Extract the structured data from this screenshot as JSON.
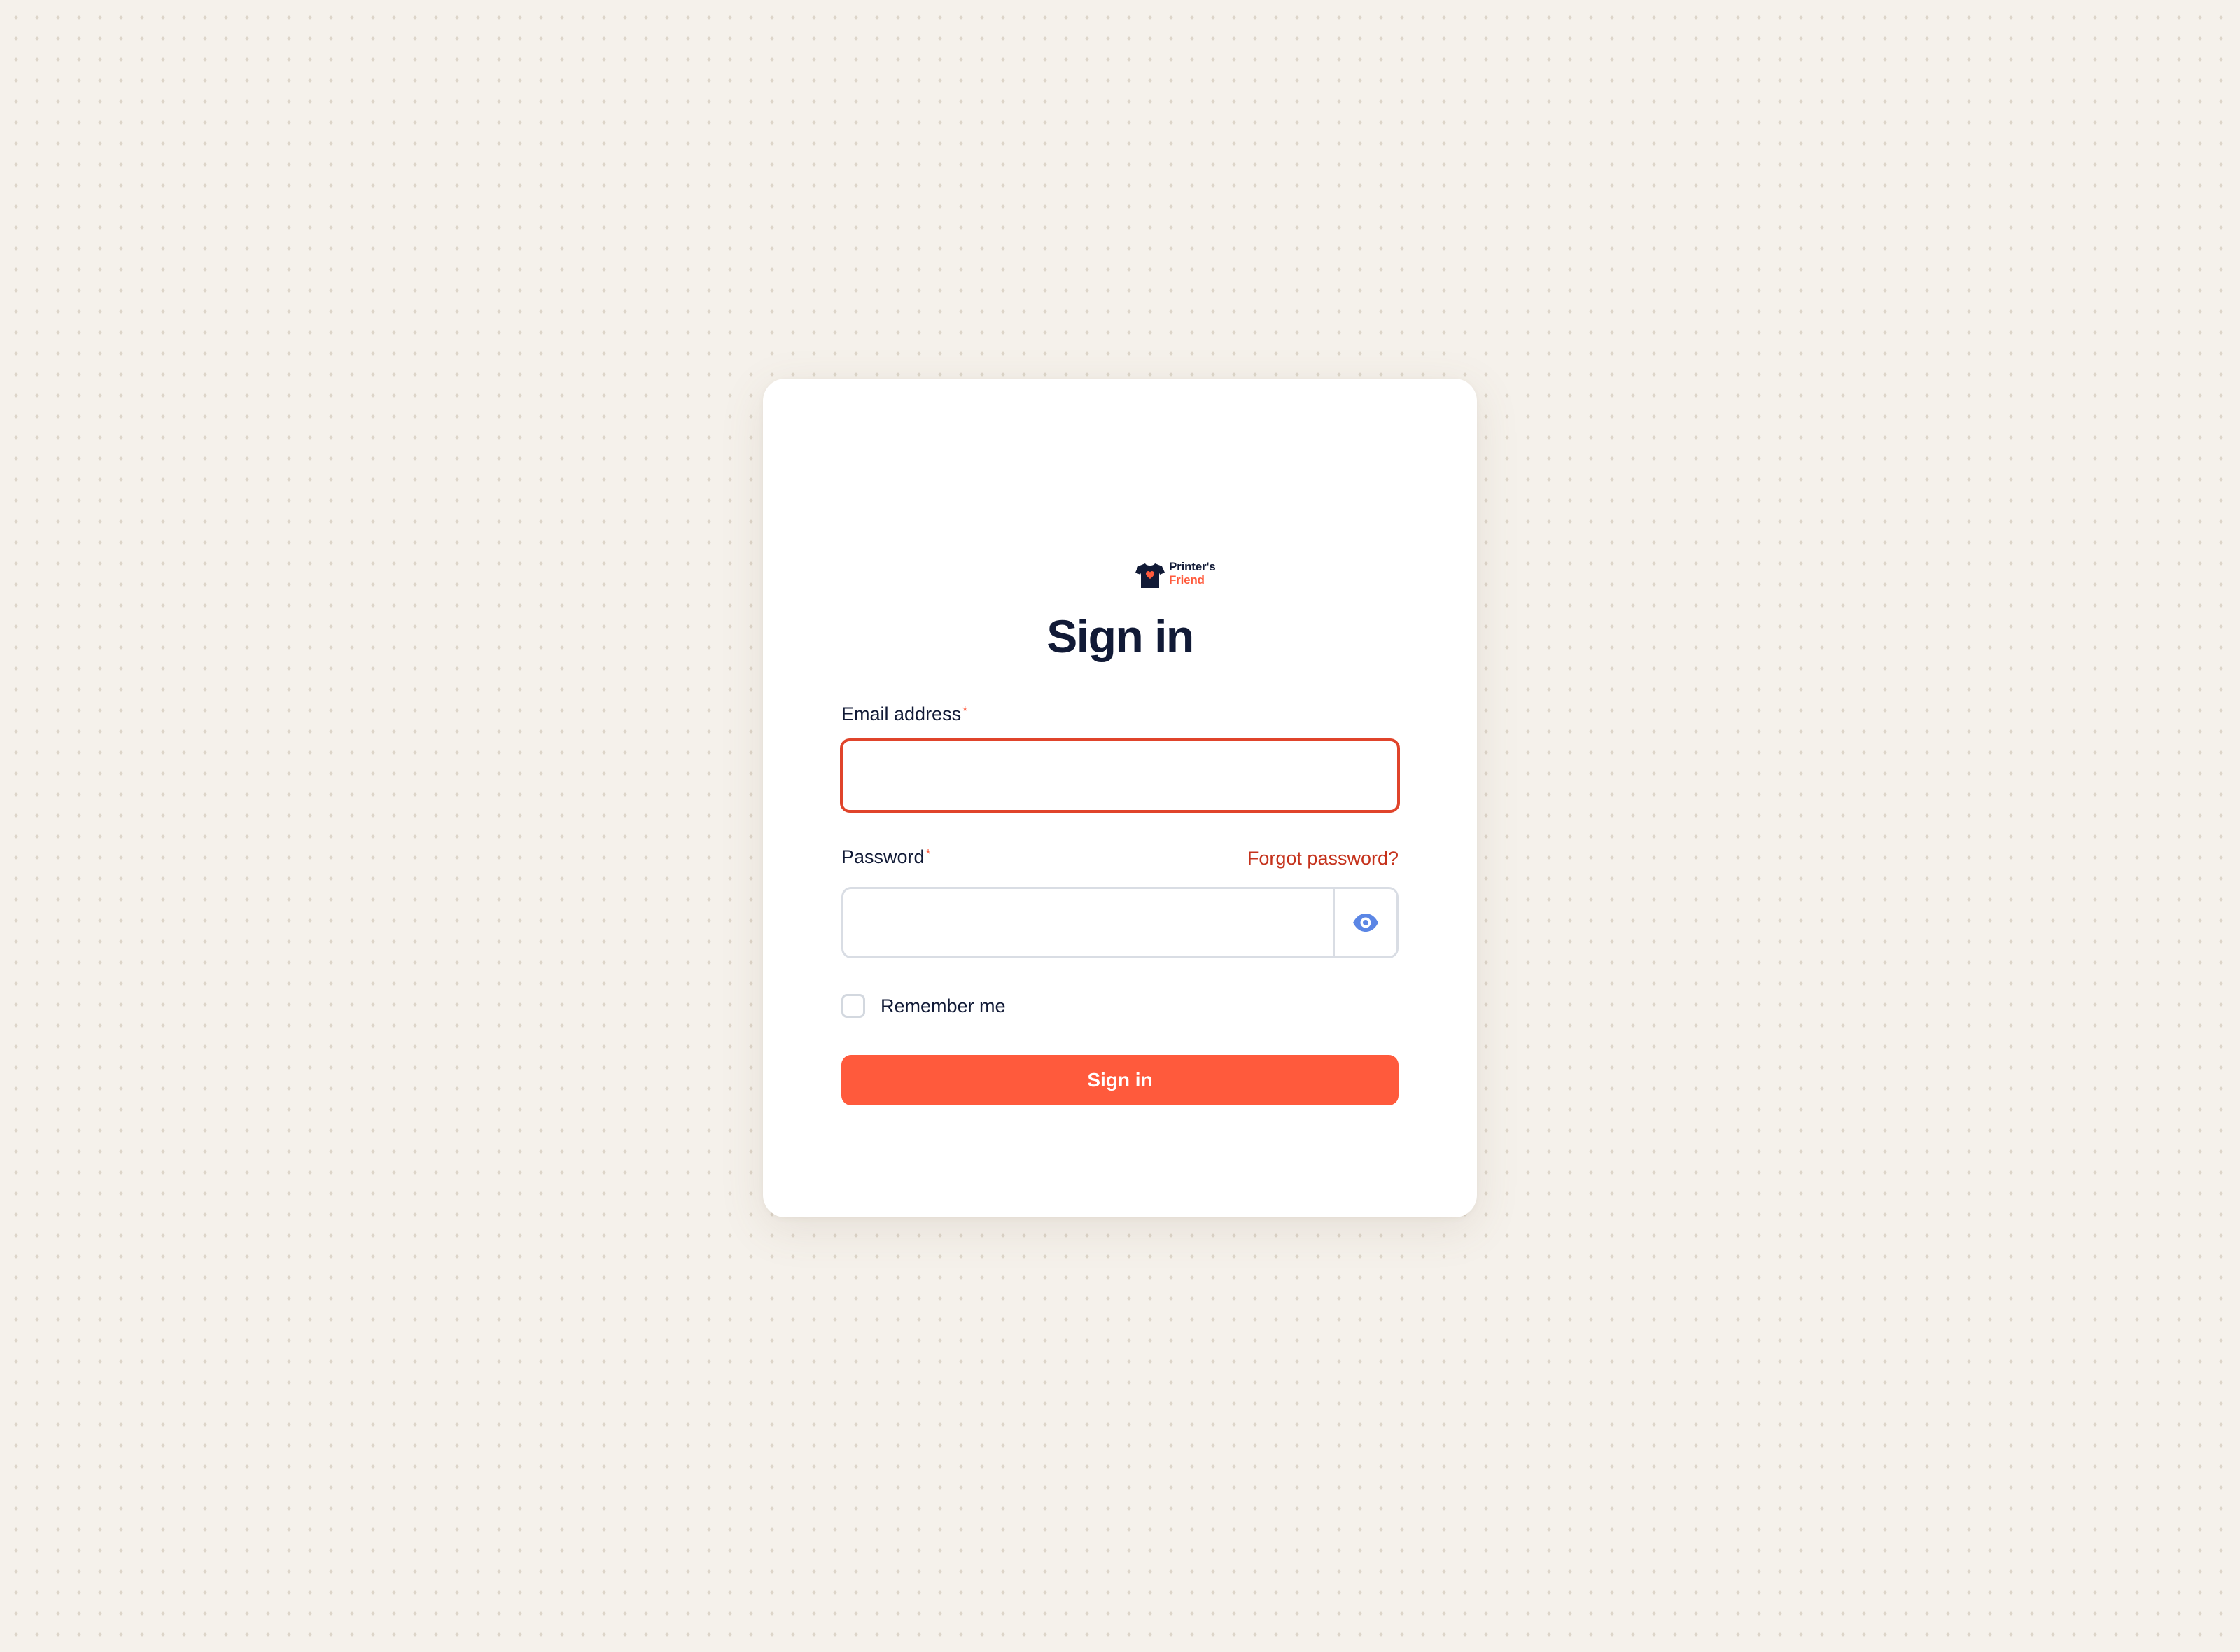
{
  "brand": {
    "name_line1": "Printer's",
    "name_line2": "Friend",
    "icon": "tshirt-heart-icon",
    "colors": {
      "navy": "#111a36",
      "accent": "#ff5a3c",
      "error": "#e0442b",
      "link": "#c5321c",
      "background": "#f5f1eb"
    }
  },
  "page": {
    "title": "Sign in"
  },
  "form": {
    "email": {
      "label": "Email address",
      "required_mark": "*",
      "value": "",
      "placeholder": "",
      "state": "error"
    },
    "password": {
      "label": "Password",
      "required_mark": "*",
      "value": "",
      "placeholder": "",
      "toggle_icon": "eye-icon"
    },
    "forgot_password_label": "Forgot password?",
    "remember_me": {
      "label": "Remember me",
      "checked": false
    },
    "submit_label": "Sign in"
  }
}
